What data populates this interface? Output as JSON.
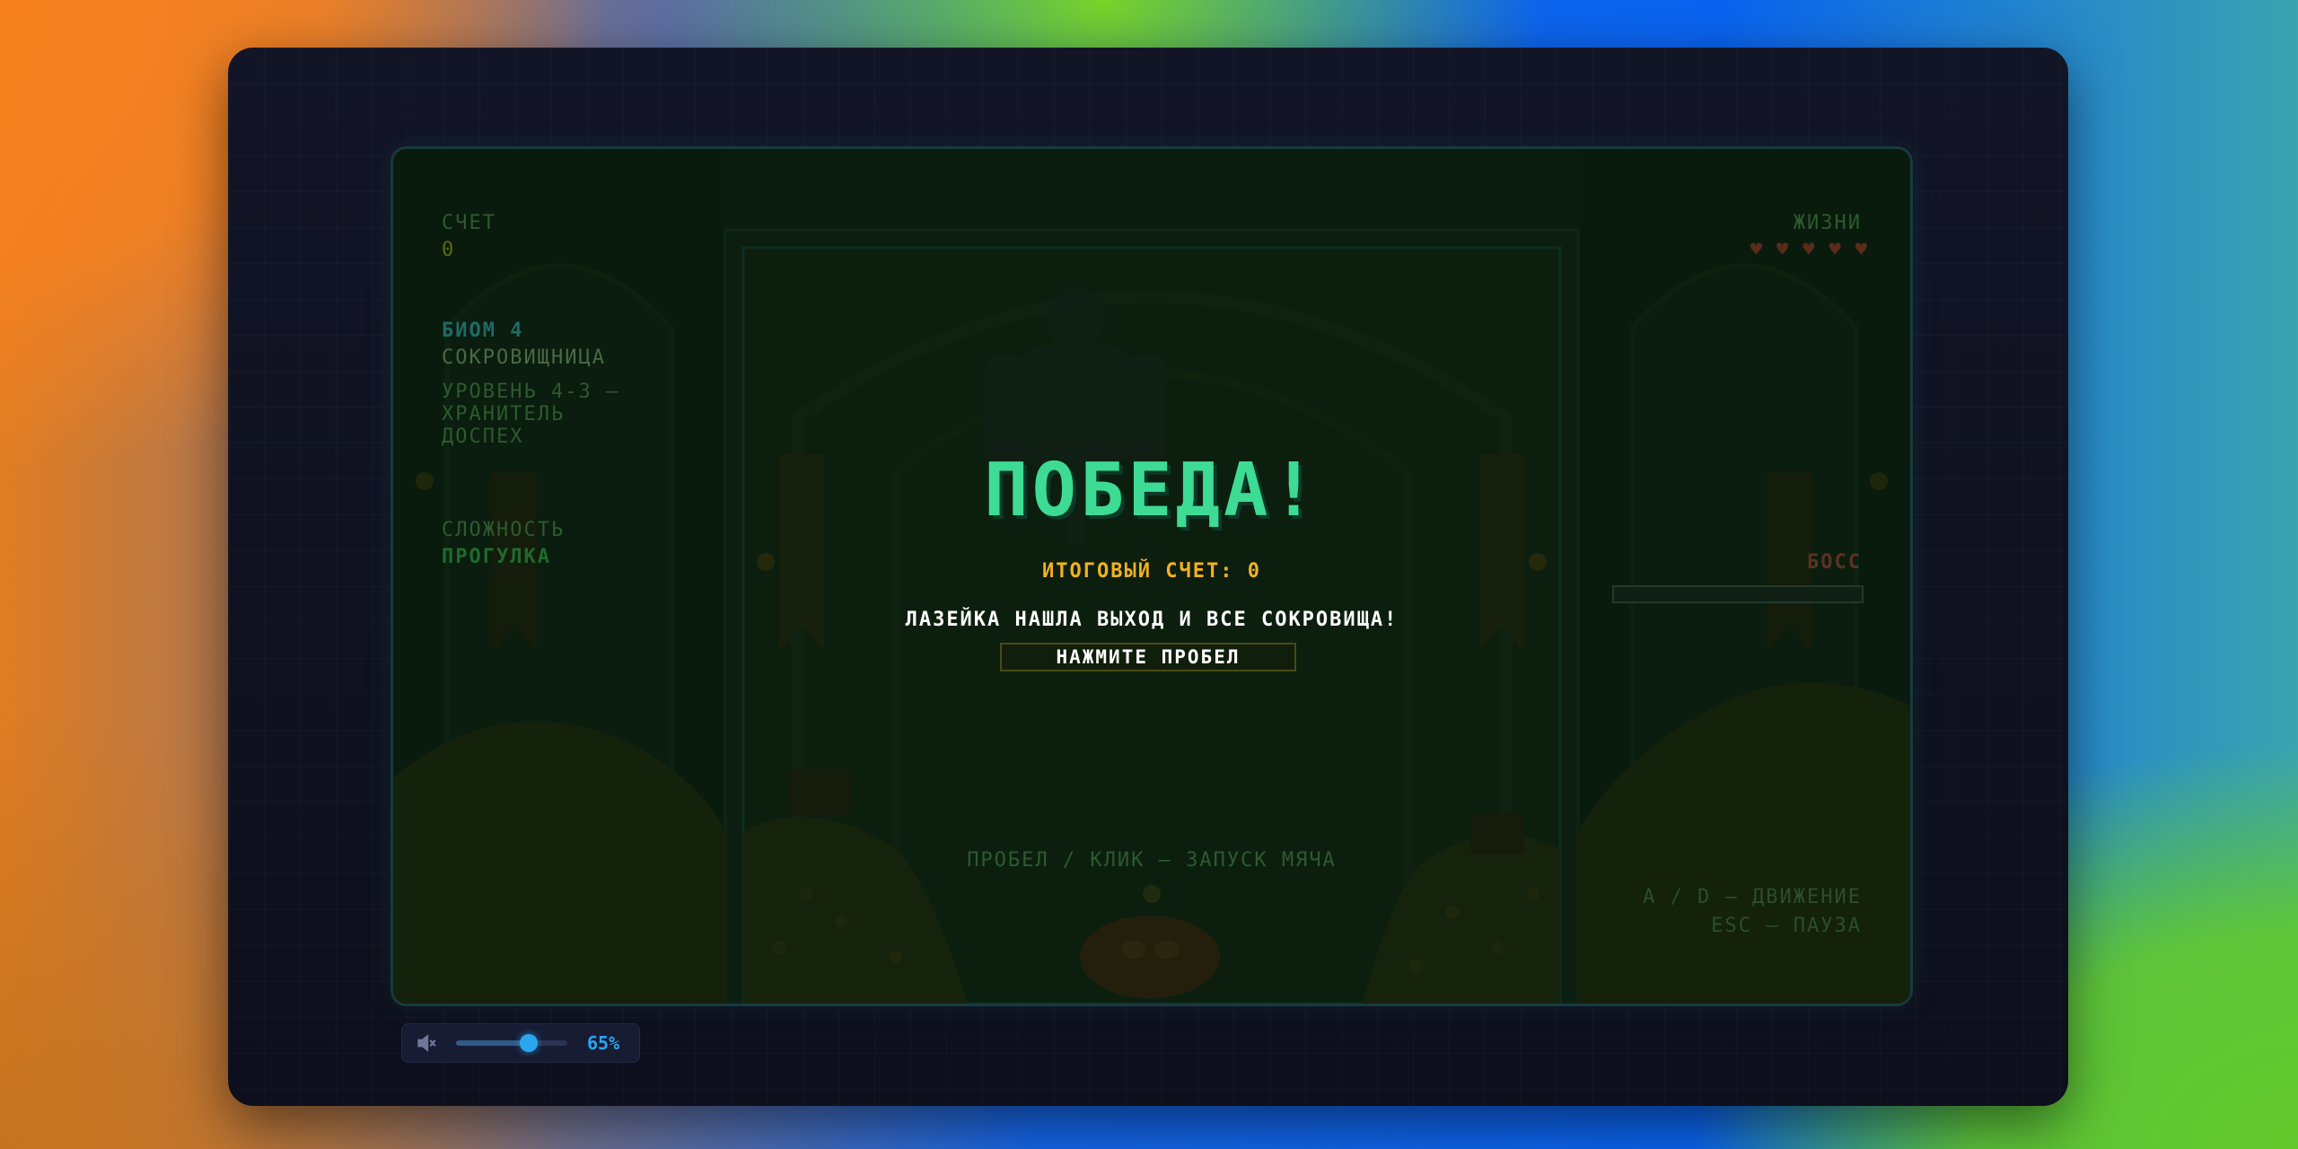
{
  "hud": {
    "score_label": "СЧЕТ",
    "score_value": "0",
    "biome_label": "БИОМ 4",
    "biome_name": "СОКРОВИЩНИЦА",
    "level_name": "УРОВЕНЬ 4-3 — ХРАНИТЕЛЬ ДОСПЕХ",
    "difficulty_label": "СЛОЖНОСТЬ",
    "difficulty_value": "ПРОГУЛКА",
    "lives_label": "ЖИЗНИ",
    "lives_count": 5,
    "boss_label": "БОСС",
    "boss_health": 0,
    "controls_line1": "A / D — ДВИЖЕНИЕ",
    "controls_line2": "ESC — ПАУЗА",
    "launch_hint": "ПРОБЕЛ / КЛИК — ЗАПУСК МЯЧА"
  },
  "victory": {
    "title": "ПОБЕДА!",
    "final_score": "ИТОГОВЫЙ СЧЕТ: 0",
    "message": "ЛАЗЕЙКА НАШЛА ВЫХОД И ВСЕ СОКРОВИЩА!",
    "prompt": "НАЖМИТЕ ПРОБЕЛ"
  },
  "volume": {
    "value": 0.65,
    "label": "65%"
  },
  "colors": {
    "victory": "#3ddb94",
    "final_score": "#f3b11f",
    "accent": "#2aa6f0"
  }
}
